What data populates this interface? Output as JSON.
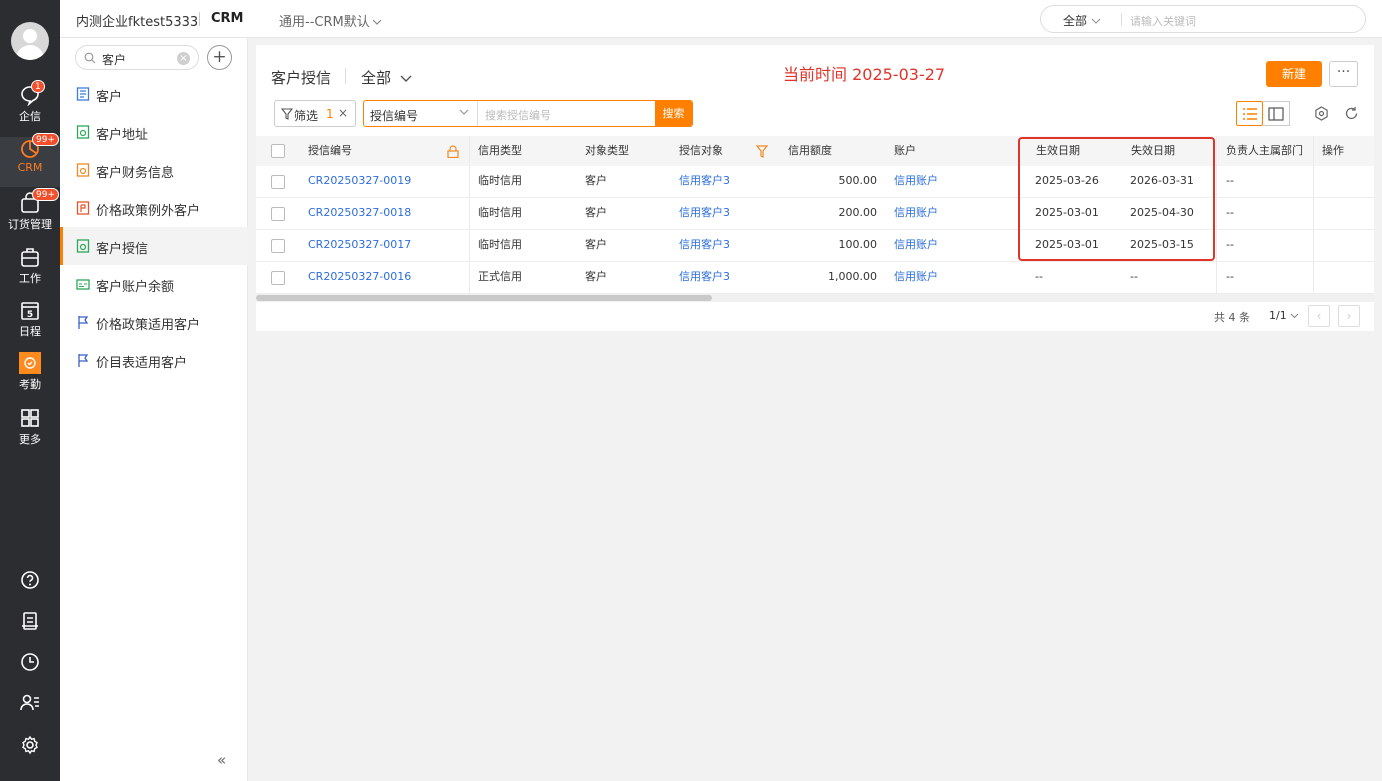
{
  "rail": {
    "items": [
      {
        "label": "企信",
        "badge": "1"
      },
      {
        "label": "CRM",
        "badge": "99+"
      },
      {
        "label": "订货管理",
        "badge": "99+"
      },
      {
        "label": "工作"
      },
      {
        "label": "日程",
        "day": "5"
      },
      {
        "label": "考勤"
      },
      {
        "label": "更多"
      }
    ]
  },
  "topbar": {
    "company": "内测企业fktest5333",
    "app": "CRM",
    "view": "通用--CRM默认",
    "search_scope": "全部",
    "search_placeholder": "请输入关键词"
  },
  "sidenav": {
    "search_value": "客户",
    "items": [
      {
        "label": "客户",
        "icon": "doc-blue"
      },
      {
        "label": "客户地址",
        "icon": "doc-green"
      },
      {
        "label": "客户财务信息",
        "icon": "doc-orange"
      },
      {
        "label": "价格政策例外客户",
        "icon": "doc-red"
      },
      {
        "label": "客户授信",
        "icon": "doc-green",
        "active": true
      },
      {
        "label": "客户账户余额",
        "icon": "card-green"
      },
      {
        "label": "价格政策适用客户",
        "icon": "flag-blue"
      },
      {
        "label": "价目表适用客户",
        "icon": "flag-blue"
      }
    ]
  },
  "panel": {
    "title": "客户授信",
    "scope": "全部",
    "current_time": "当前时间 2025-03-27",
    "new_label": "新建",
    "more_label": "···",
    "filter_label": "筛选",
    "filter_count": "1",
    "search_field": "授信编号",
    "search_placeholder": "搜索授信编号",
    "search_button": "搜索"
  },
  "table": {
    "columns": [
      "授信编号",
      "信用类型",
      "对象类型",
      "授信对象",
      "信用额度",
      "账户",
      "生效日期",
      "失效日期",
      "负责人主属部门",
      "操作"
    ],
    "rows": [
      {
        "code": "CR20250327-0019",
        "type": "临时信用",
        "obj_type": "客户",
        "obj": "信用客户3",
        "amount": "500.00",
        "account": "信用账户",
        "start": "2025-03-26",
        "end": "2026-03-31",
        "dept": "--"
      },
      {
        "code": "CR20250327-0018",
        "type": "临时信用",
        "obj_type": "客户",
        "obj": "信用客户3",
        "amount": "200.00",
        "account": "信用账户",
        "start": "2025-03-01",
        "end": "2025-04-30",
        "dept": "--"
      },
      {
        "code": "CR20250327-0017",
        "type": "临时信用",
        "obj_type": "客户",
        "obj": "信用客户3",
        "amount": "100.00",
        "account": "信用账户",
        "start": "2025-03-01",
        "end": "2025-03-15",
        "dept": "--"
      },
      {
        "code": "CR20250327-0016",
        "type": "正式信用",
        "obj_type": "客户",
        "obj": "信用客户3",
        "amount": "1,000.00",
        "account": "信用账户",
        "start": "--",
        "end": "--",
        "dept": "--"
      }
    ]
  },
  "pager": {
    "total": "共 4 条",
    "page": "1/1"
  }
}
